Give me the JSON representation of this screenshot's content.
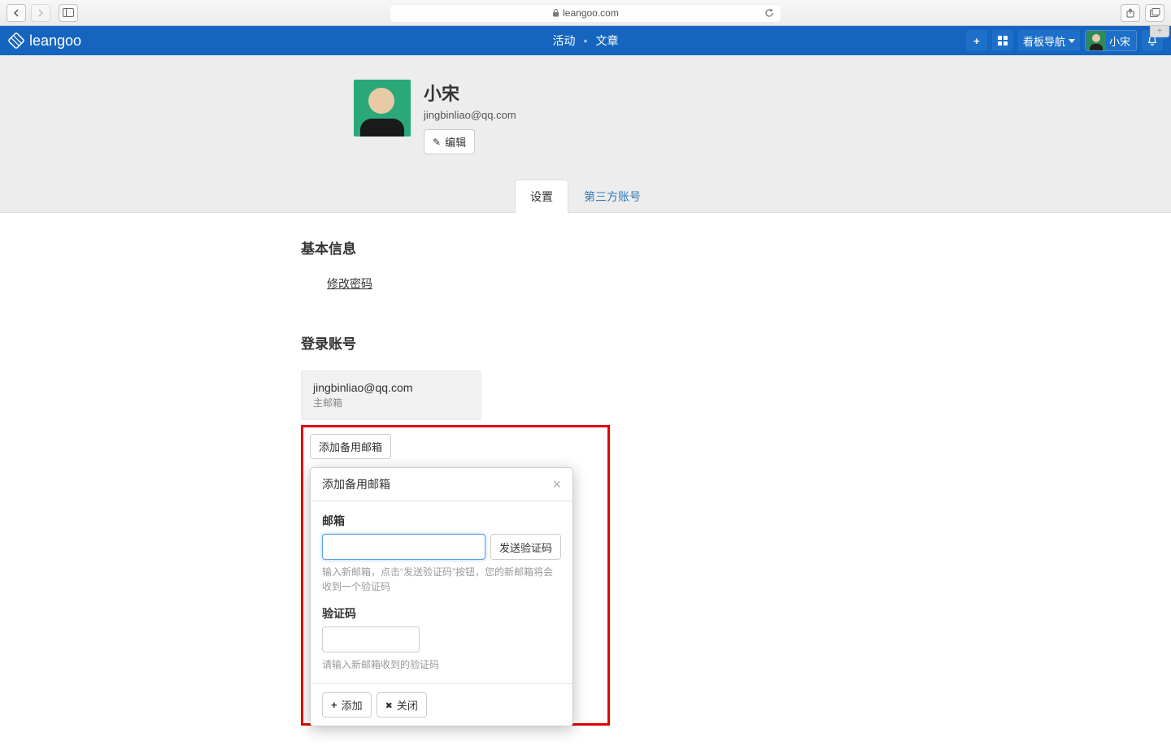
{
  "browser": {
    "url_host": "leangoo.com"
  },
  "app_bar": {
    "brand": "leangoo",
    "center_links": {
      "activity": "活动",
      "article": "文章"
    },
    "board_nav": "看板导航",
    "username": "小宋"
  },
  "profile": {
    "name": "小宋",
    "email": "jingbinliao@qq.com",
    "edit_label": "编辑"
  },
  "tabs": {
    "settings": "设置",
    "third_party": "第三方账号"
  },
  "sections": {
    "basic_info": "基本信息",
    "change_password": "修改密码",
    "login_account": "登录账号"
  },
  "account_card": {
    "email": "jingbinliao@qq.com",
    "tag": "主邮箱"
  },
  "add_backup_button": "添加备用邮箱",
  "modal": {
    "title": "添加备用邮箱",
    "email_label": "邮箱",
    "send_code": "发送验证码",
    "email_help": "输入新邮箱，点击“发送验证码”按钮，您的新邮箱将会收到一个验证码",
    "code_label": "验证码",
    "code_help": "请输入新邮箱收到的验证码",
    "add": "添加",
    "close": "关闭"
  }
}
